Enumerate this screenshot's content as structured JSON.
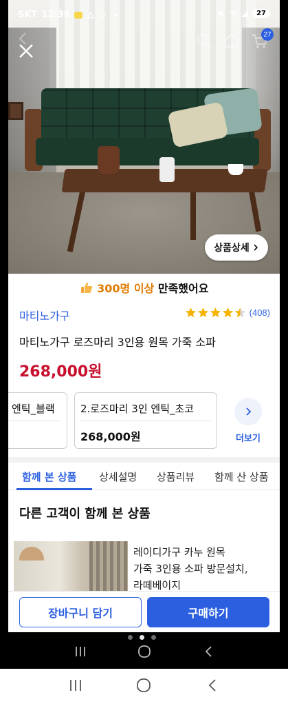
{
  "status_bar": {
    "carrier": "SKT",
    "time": "12:36",
    "battery": "27"
  },
  "hero": {
    "cart_badge": "27",
    "detail_chip": "상품상세"
  },
  "satisfaction": {
    "count": "300명 이상",
    "suffix": "만족했어요"
  },
  "product": {
    "brand": "마티노가구",
    "rating": 4.5,
    "review_count": "(408)",
    "title": "마티노가구 로즈마리 3인용 원목 가죽 소파",
    "price": "268,000원"
  },
  "options": [
    {
      "name": "엔틱_블랙",
      "price": ""
    },
    {
      "name": "2.로즈마리 3인 엔틱_초코",
      "price": "268,000원"
    }
  ],
  "more_label": "더보기",
  "tabs": [
    {
      "label": "함께 본 상품"
    },
    {
      "label": "상세설명"
    },
    {
      "label": "상품리뷰"
    },
    {
      "label": "함께 산 상품"
    }
  ],
  "section_title": "다른 고객이 함께 본 상품",
  "related": {
    "line1": "레이디가구 카누 원목",
    "line2": "가죽 3인용 소파 방문설치,",
    "line3": "라떼베이지"
  },
  "actions": {
    "cart_add": "장바구니 담기",
    "buy_now": "구매하기"
  },
  "colors": {
    "accent": "#2b5fe0",
    "price": "#c8102e",
    "highlight": "#e07a00"
  }
}
